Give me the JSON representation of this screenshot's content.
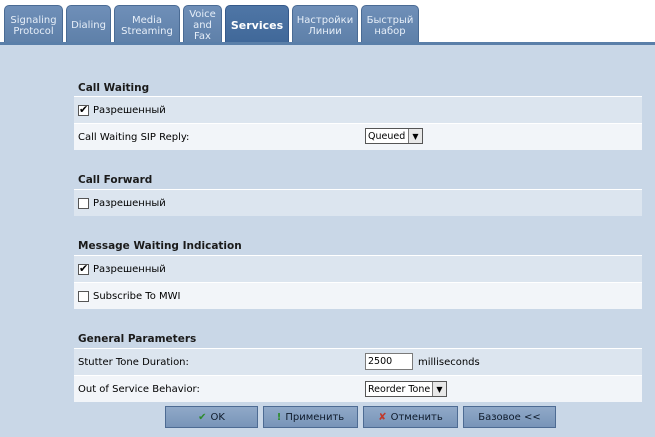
{
  "tabs": [
    {
      "label_lines": [
        "Signaling",
        "Protocol"
      ]
    },
    {
      "label_lines": [
        "Dialing"
      ]
    },
    {
      "label_lines": [
        "Media",
        "Streaming"
      ]
    },
    {
      "label_lines": [
        "Voice",
        "and",
        "Fax"
      ]
    },
    {
      "label_lines": [
        "Services"
      ]
    },
    {
      "label_lines": [
        "Настройки",
        "Линии"
      ]
    },
    {
      "label_lines": [
        "Быстрый",
        "набор"
      ]
    }
  ],
  "call_waiting": {
    "title": "Call Waiting",
    "enabled_label": "Разрешенный",
    "enabled": true,
    "sip_reply_label": "Call Waiting SIP Reply:",
    "sip_reply_value": "Queued"
  },
  "call_forward": {
    "title": "Call Forward",
    "enabled_label": "Разрешенный",
    "enabled": false
  },
  "mwi": {
    "title": "Message Waiting Indication",
    "enabled_label": "Разрешенный",
    "enabled": true,
    "subscribe_label": "Subscribe To MWI",
    "subscribe": false
  },
  "general": {
    "title": "General Parameters",
    "stutter_label": "Stutter Tone Duration:",
    "stutter_value": "2500",
    "stutter_unit": "milliseconds",
    "oos_label": "Out of Service Behavior:",
    "oos_value": "Reorder Tone"
  },
  "buttons": {
    "ok": "OK",
    "apply": "Применить",
    "cancel": "Отменить",
    "basic": "Базовое <<"
  }
}
